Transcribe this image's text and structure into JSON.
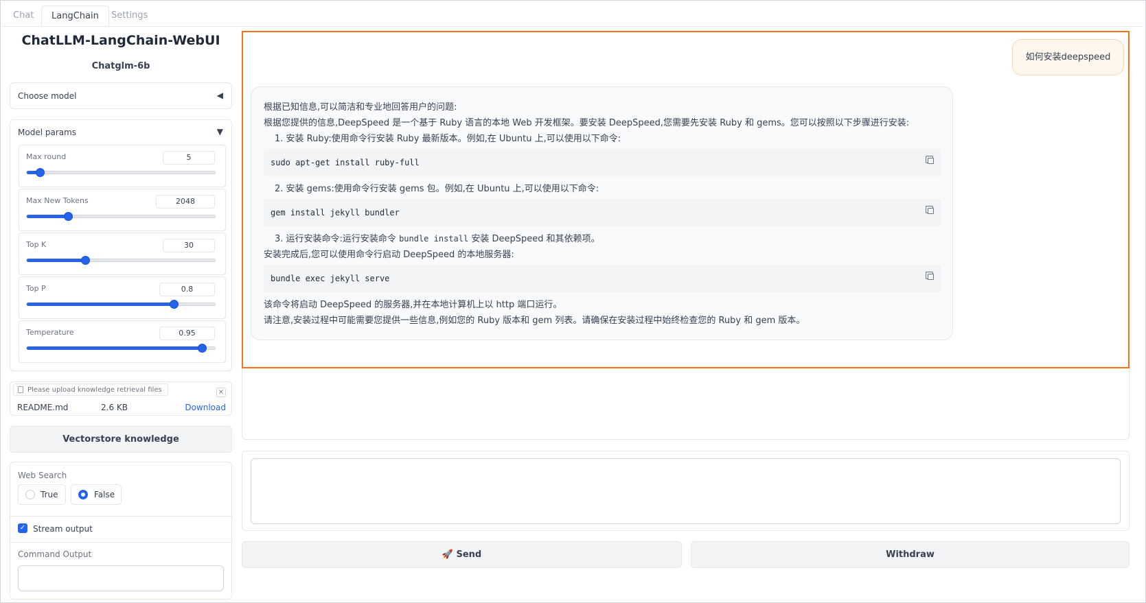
{
  "tabs": [
    {
      "label": "Chat"
    },
    {
      "label": "LangChain"
    },
    {
      "label": "Settings"
    }
  ],
  "sidebar": {
    "title": "ChatLLM-LangChain-WebUI",
    "subtitle": "Chatglm-6b",
    "choose_model": {
      "label": "Choose model",
      "arrow": "◀"
    },
    "model_params": {
      "label": "Model params",
      "arrow": "▼",
      "params": [
        {
          "label": "Max round",
          "value": "5",
          "fraction": 0.07
        },
        {
          "label": "Max New Tokens",
          "value": "2048",
          "fraction": 0.22
        },
        {
          "label": "Top K",
          "value": "30",
          "fraction": 0.31
        },
        {
          "label": "Top P",
          "value": "0.8",
          "fraction": 0.78
        },
        {
          "label": "Temperature",
          "value": "0.95",
          "fraction": 0.93
        }
      ]
    },
    "upload": {
      "placeholder": "Please upload knowledge retrieval files",
      "close": "×",
      "file_name": "README.md",
      "file_size": "2.6 KB",
      "download": "Download"
    },
    "vectorstore_button": "Vectorstore knowledge",
    "web_search": {
      "label": "Web Search",
      "options": [
        "True",
        "False"
      ],
      "selected": "False"
    },
    "stream_output": {
      "label": "Stream output",
      "checked": true,
      "check": "✓"
    },
    "command_output": {
      "label": "Command Output",
      "value": ""
    }
  },
  "chat": {
    "user_message": "如何安装deepspeed",
    "bot": {
      "l1": "根据已知信息,可以简洁和专业地回答用户的问题:",
      "l2": "根据您提供的信息,DeepSpeed 是一个基于 Ruby 语言的本地 Web 开发框架。要安装 DeepSpeed,您需要先安装 Ruby 和 gems。您可以按照以下步骤进行安装:",
      "l3": "1. 安装 Ruby:使用命令行安装 Ruby 最新版本。例如,在 Ubuntu 上,可以使用以下命令:",
      "code1": "sudo apt-get install ruby-full",
      "l4": "2. 安装 gems:使用命令行安装 gems 包。例如,在 Ubuntu 上,可以使用以下命令:",
      "code2": "gem install jekyll bundler",
      "l5_pre": "3. 运行安装命令:运行安装命令 ",
      "l5_code": "bundle install",
      "l5_post": " 安装 DeepSpeed 和其依赖项。",
      "l6": "安装完成后,您可以使用命令行启动 DeepSpeed 的本地服务器:",
      "code3": "bundle exec jekyll serve",
      "l7": "该命令将启动 DeepSpeed 的服务器,并在本地计算机上以 http 端口运行。",
      "l8": "请注意,安装过程中可能需要您提供一些信息,例如您的 Ruby 版本和 gem 列表。请确保在安装过程中始终检查您的 Ruby 和 gem 版本。"
    }
  },
  "input": {
    "value": ""
  },
  "buttons": {
    "send": "Send",
    "send_icon": "🚀",
    "withdraw": "Withdraw"
  },
  "colors": {
    "accent": "#2563eb",
    "highlight": "#f97316",
    "user_bubble": "#fff7ed"
  }
}
